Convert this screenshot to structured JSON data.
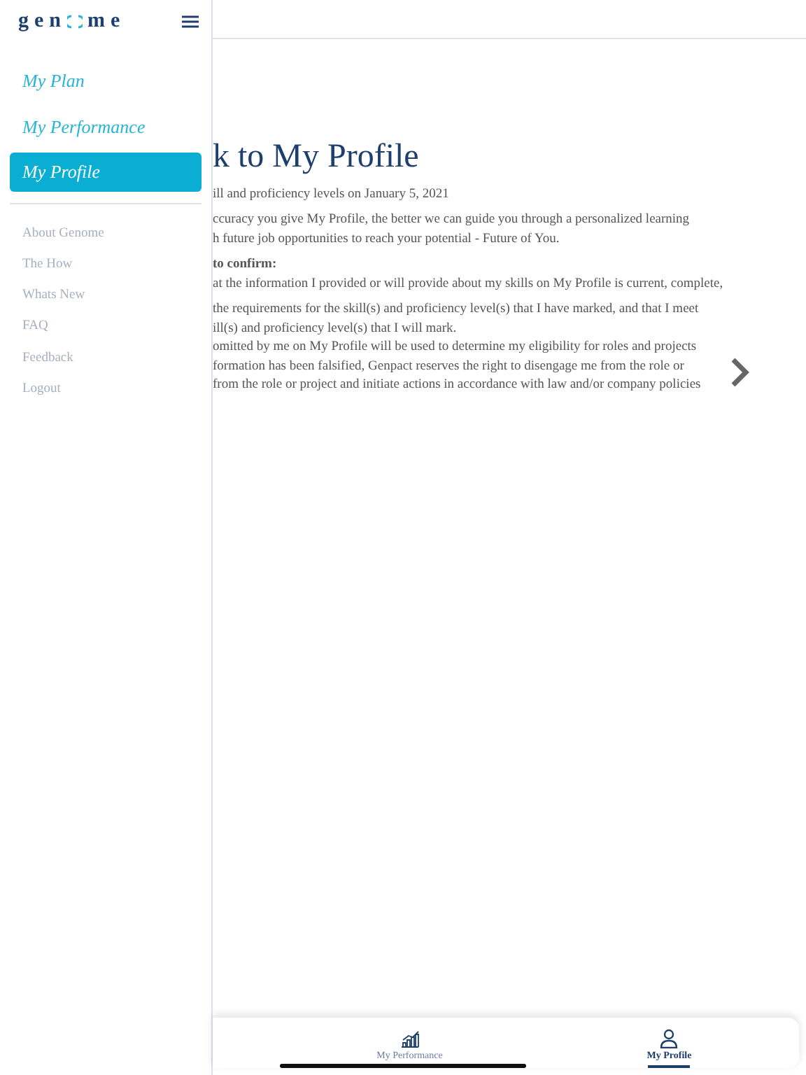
{
  "sidebar": {
    "logo": {
      "before": "gen",
      "after": "me"
    },
    "nav": [
      {
        "label": "My Plan",
        "selected": false
      },
      {
        "label": "My Performance",
        "selected": false
      },
      {
        "label": "My Profile",
        "selected": true
      }
    ],
    "link_groups": [
      [
        "About Genome"
      ],
      [
        "The How"
      ],
      [
        "Whats New",
        "FAQ",
        "Feedback",
        "Logout"
      ]
    ]
  },
  "main": {
    "heading": "k to My Profile",
    "paragraphs": [
      [
        {
          "text": "ill and proficiency levels on January 5, 2021",
          "kind": "plain"
        }
      ],
      [
        {
          "text": "ccuracy you give My Profile, the better we can guide you through a personalized learning",
          "kind": "plain"
        },
        {
          "text": "h future job opportunities to reach your potential - Future of You.",
          "kind": "plain"
        }
      ],
      [
        {
          "text": "to confirm:",
          "kind": "bold"
        },
        {
          "text": "at the information I provided or will provide about my skills on My Profile is current, complete,",
          "kind": "plain"
        }
      ],
      [
        {
          "text": "the requirements for the skill(s) and proficiency level(s) that I have marked, and that I meet",
          "kind": "plain"
        },
        {
          "text": "ill(s) and proficiency level(s) that I will mark.",
          "kind": "plain"
        },
        {
          "text": "omitted by me on My Profile will be used to determine my eligibility for roles and projects",
          "kind": "plain"
        },
        {
          "text": "formation has been falsified, Genpact reserves the right to disengage me from the role or",
          "kind": "plain"
        },
        {
          "text": "from the role or project and initiate actions in accordance with law and/or company policies",
          "kind": "plain"
        }
      ]
    ]
  },
  "bottom_nav": [
    {
      "label": "My Performance",
      "selected": false
    },
    {
      "label": "My Profile",
      "selected": true
    }
  ]
}
